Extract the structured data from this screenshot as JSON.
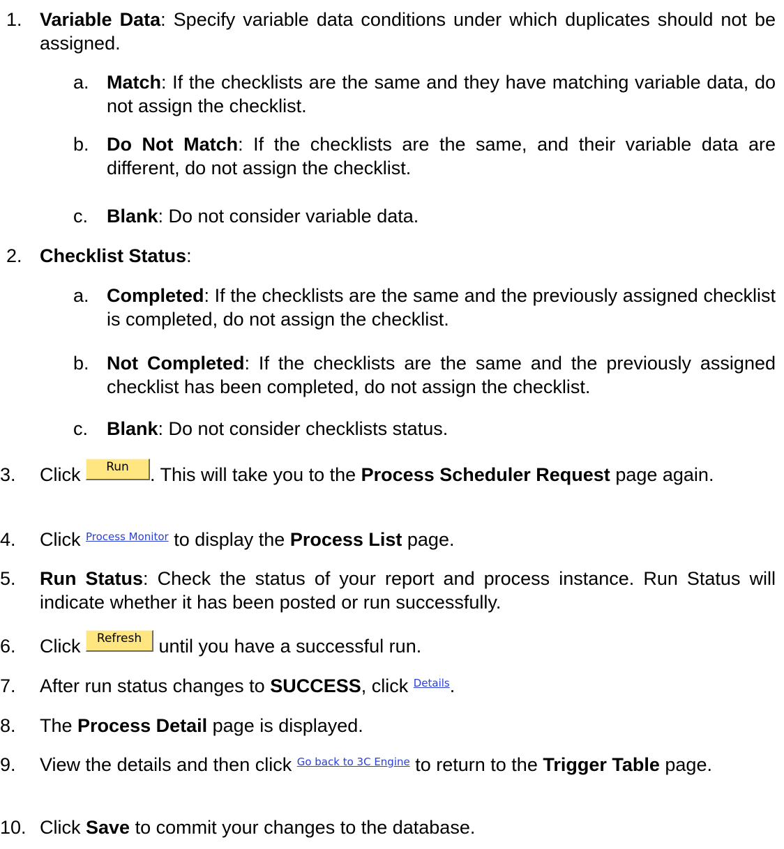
{
  "steps": [
    {
      "num": "1.",
      "title": "Variable Data",
      "text": ":  Specify variable data conditions under which duplicates should not be assigned."
    },
    {
      "num": "a.",
      "title": "Match",
      "text": ":  If the checklists are the same and they have matching variable data, do not assign the checklist."
    },
    {
      "num": "b.",
      "title": "Do Not Match",
      "text": ":  If the checklists are the same, and their variable data are different, do not assign the checklist."
    },
    {
      "num": "c.",
      "title": "Blank",
      "text": ":  Do not consider variable data."
    },
    {
      "num": "2.",
      "title": "Checklist Status",
      "text": ":"
    },
    {
      "num": "a.",
      "title": "Completed",
      "text": ":  If the checklists are the same and the previously assigned checklist is completed, do not assign the checklist."
    },
    {
      "num": "b.",
      "title": "Not Completed",
      "text": ":  If the checklists are the same and the previously assigned checklist has been completed, do not assign the checklist."
    },
    {
      "num": "c.",
      "title": "Blank",
      "text": ":  Do not consider checklists status."
    },
    {
      "num": "3.",
      "pre": "Click ",
      "button": "Run",
      "mid": ".  This will take you to the ",
      "bold": "Process Scheduler Request",
      "post": " page again."
    },
    {
      "num": "4.",
      "pre": "Click ",
      "link": "Process Monitor",
      "mid": " to display the ",
      "bold": "Process List",
      "post": " page."
    },
    {
      "num": "5.",
      "title": "Run Status",
      "text": ":  Check the status of your report and process instance.  Run Status will indicate whether it has been posted or run successfully."
    },
    {
      "num": "6.",
      "pre": "Click ",
      "button": "Refresh",
      "post": " until you have a successful run."
    },
    {
      "num": "7.",
      "pre": "After run status changes to ",
      "bold": "SUCCESS",
      "mid": ", click ",
      "link": "Details",
      "post": "."
    },
    {
      "num": "8.",
      "pre": "The ",
      "bold": "Process Detail",
      "post": " page is displayed."
    },
    {
      "num": "9.",
      "pre": "View the details and then click ",
      "link": "Go back to 3C Engine",
      "mid": " to return to the ",
      "bold": "Trigger Table",
      "post": " page."
    },
    {
      "num": "10.",
      "pre": "Click ",
      "bold": "Save",
      "post": " to commit your changes to the database."
    }
  ]
}
